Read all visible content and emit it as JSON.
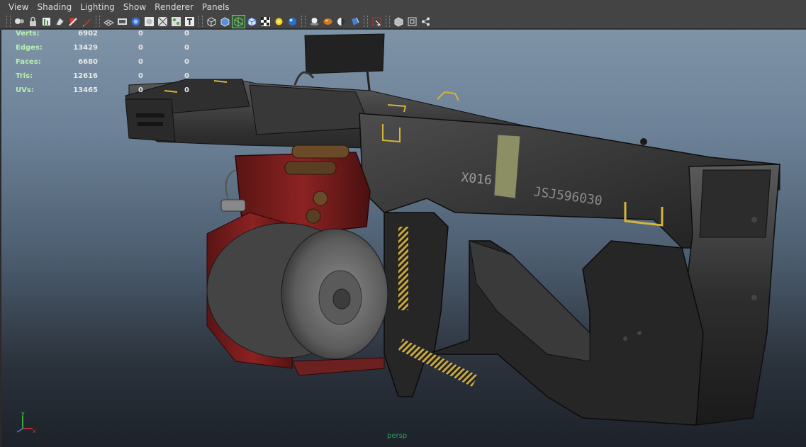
{
  "menu": {
    "items": [
      "View",
      "Shading",
      "Lighting",
      "Show",
      "Renderer",
      "Panels"
    ]
  },
  "toolbar": {
    "groups": [
      [
        "select-camera",
        "lock-camera",
        "camera-attributes",
        "bookmarks",
        "image-plane",
        "grease-pencil"
      ],
      [
        "grid",
        "film-gate",
        "resolution-gate",
        "gate-mask",
        "field-chart",
        "safe-action",
        "safe-title"
      ],
      [
        "wireframe",
        "smooth-shade",
        "wireframe-on-shaded",
        "textured",
        "use-all-lights",
        "shadows",
        "screen-space-ao"
      ],
      [
        "motion-blur",
        "anti-aliasing",
        "depth-of-field",
        "isolate-select"
      ],
      [
        "xray",
        "xray-joints",
        "xray-components"
      ]
    ],
    "active": "wireframe-on-shaded"
  },
  "hud": {
    "rows": [
      {
        "label": "Verts:",
        "v1": "6902",
        "v2": "0",
        "v3": "0"
      },
      {
        "label": "Edges:",
        "v1": "13429",
        "v2": "0",
        "v3": "0"
      },
      {
        "label": "Faces:",
        "v1": "6680",
        "v2": "0",
        "v3": "0"
      },
      {
        "label": "Tris:",
        "v1": "12616",
        "v2": "0",
        "v3": "0"
      },
      {
        "label": "UVs:",
        "v1": "13465",
        "v2": "0",
        "v3": "0"
      }
    ]
  },
  "model": {
    "decal_serial": "X016",
    "decal_id": "JSJ596030"
  },
  "viewport": {
    "camera": "persp",
    "axis_y": "y",
    "axis_x": "x"
  }
}
